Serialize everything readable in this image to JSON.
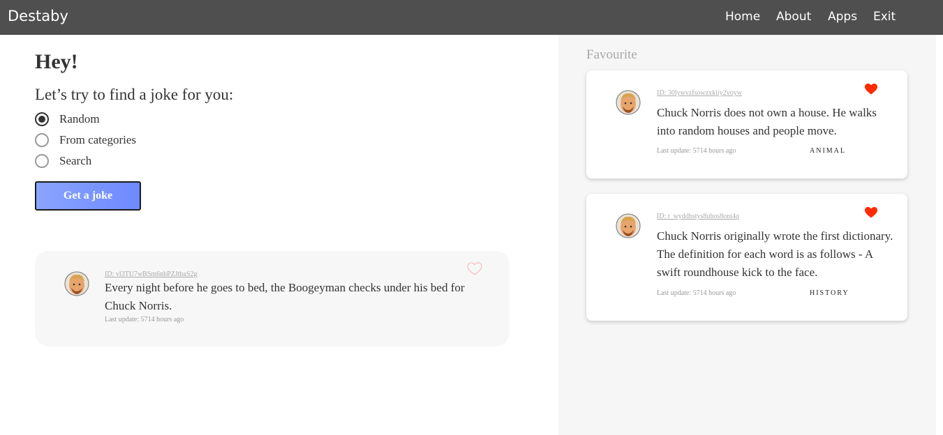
{
  "header": {
    "brand": "Destaby",
    "nav": [
      "Home",
      "About",
      "Apps",
      "Exit"
    ]
  },
  "main": {
    "greeting": "Hey!",
    "prompt": "Let’s try to find a joke for you:",
    "options": [
      {
        "label": "Random",
        "checked": true
      },
      {
        "label": "From categories",
        "checked": false
      },
      {
        "label": "Search",
        "checked": false
      }
    ],
    "button_label": "Get a joke",
    "joke": {
      "id": "ID: vl3TU7wBSm6nbPZJtbaS2g",
      "text": "Every night before he goes to bed, the Boogeyman checks under his bed for Chuck Norris.",
      "meta": "Last update: 5714 hours ago",
      "favourite": false
    }
  },
  "favourites": {
    "title": "Favourite",
    "items": [
      {
        "id": "ID: 30lywvzfsowzxkiiy2voyw",
        "text": "Chuck Norris does not own a house. He walks into random houses and people move.",
        "meta": "Last update: 5714 hours ago",
        "category": "ANIMAL",
        "favourite": true
      },
      {
        "id": "ID: t_wyddbstys8ubos8oni4q",
        "text": "Chuck Norris originally wrote the first dictionary. The definition for each word is as follows - A swift roundhouse kick to the face.",
        "meta": "Last update: 5714 hours ago",
        "category": "HISTORY",
        "favourite": true
      }
    ]
  },
  "colors": {
    "topbar": "#4f4f4f",
    "button_gradient_start": "#8aa4ff",
    "button_gradient_end": "#6e89ff",
    "heart_filled": "#ff2a00",
    "heart_outline": "#f3c6c6",
    "side_panel": "#f6f6f6"
  },
  "icons": {
    "avatar": "chuck-norris-avatar-icon",
    "heart_filled": "heart-filled-icon",
    "heart_outline": "heart-outline-icon"
  }
}
